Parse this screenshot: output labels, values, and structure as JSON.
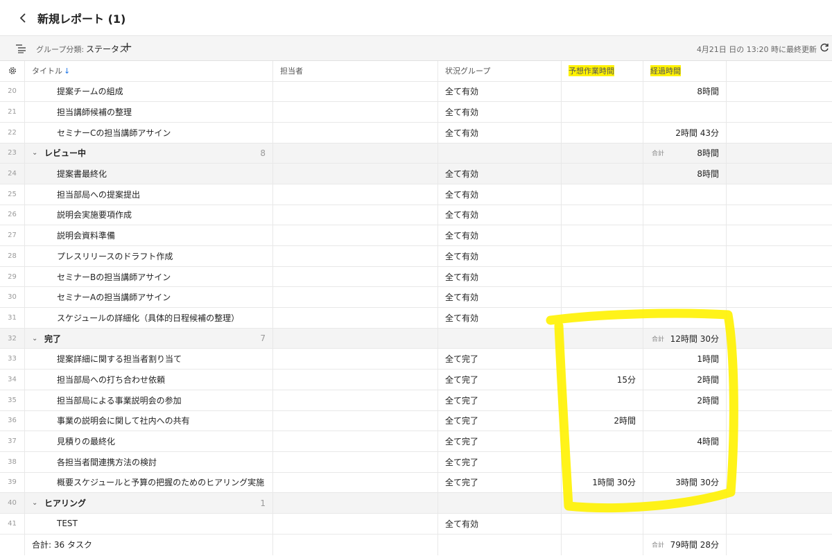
{
  "titlebar": {
    "title": "新規レポート (1)"
  },
  "toolbar": {
    "group_label": "グループ分類:",
    "group_value": "ステータス",
    "add": "+",
    "updated": "4月21日 日の 13:20 時に最終更新"
  },
  "columns": {
    "title": "タイトル",
    "sort": "↓",
    "assignee": "担当者",
    "status": "状況グループ",
    "estimate": "予想作業時間",
    "elapsed": "経過時間"
  },
  "rows": [
    {
      "n": "20",
      "title": "提案チームの組成",
      "status": "全て有効",
      "est": "",
      "elapsed": "8時間"
    },
    {
      "n": "21",
      "title": "担当講師候補の整理",
      "status": "全て有効",
      "est": "",
      "elapsed": ""
    },
    {
      "n": "22",
      "title": "セミナーCの担当講師アサイン",
      "status": "全て有効",
      "est": "",
      "elapsed": "2時間 43分"
    },
    {
      "n": "23",
      "group": "レビュー中",
      "count": "8",
      "sum_label": "合計",
      "elapsed": "8時間"
    },
    {
      "n": "24",
      "title": "提案書最終化",
      "status": "全て有効",
      "est": "",
      "elapsed": "8時間"
    },
    {
      "n": "25",
      "title": "担当部局への提案提出",
      "status": "全て有効",
      "est": "",
      "elapsed": ""
    },
    {
      "n": "26",
      "title": "説明会実施要項作成",
      "status": "全て有効",
      "est": "",
      "elapsed": ""
    },
    {
      "n": "27",
      "title": "説明会資料準備",
      "status": "全て有効",
      "est": "",
      "elapsed": ""
    },
    {
      "n": "28",
      "title": "プレスリリースのドラフト作成",
      "status": "全て有効",
      "est": "",
      "elapsed": ""
    },
    {
      "n": "29",
      "title": "セミナーBの担当講師アサイン",
      "status": "全て有効",
      "est": "",
      "elapsed": ""
    },
    {
      "n": "30",
      "title": "セミナーAの担当講師アサイン",
      "status": "全て有効",
      "est": "",
      "elapsed": ""
    },
    {
      "n": "31",
      "title": "スケジュールの詳細化（具体的日程候補の整理）",
      "status": "全て有効",
      "est": "",
      "elapsed": ""
    },
    {
      "n": "32",
      "group": "完了",
      "count": "7",
      "sum_label": "合計",
      "elapsed": "12時間 30分"
    },
    {
      "n": "33",
      "title": "提案詳細に関する担当者割り当て",
      "status": "全て完了",
      "est": "",
      "elapsed": "1時間"
    },
    {
      "n": "34",
      "title": "担当部局への打ち合わせ依頼",
      "status": "全て完了",
      "est": "15分",
      "elapsed": "2時間"
    },
    {
      "n": "35",
      "title": "担当部局による事業説明会の参加",
      "status": "全て完了",
      "est": "",
      "elapsed": "2時間"
    },
    {
      "n": "36",
      "title": "事業の説明会に関して社内への共有",
      "status": "全て完了",
      "est": "2時間",
      "elapsed": ""
    },
    {
      "n": "37",
      "title": "見積りの最終化",
      "status": "全て完了",
      "est": "",
      "elapsed": "4時間"
    },
    {
      "n": "38",
      "title": "各担当者間連携方法の検討",
      "status": "全て完了",
      "est": "",
      "elapsed": ""
    },
    {
      "n": "39",
      "title": "概要スケジュールと予算の把握のためのヒアリング実施",
      "status": "全て完了",
      "est": "1時間 30分",
      "elapsed": "3時間 30分"
    },
    {
      "n": "40",
      "group": "ヒアリング",
      "count": "1",
      "sum_label": "",
      "elapsed": ""
    },
    {
      "n": "41",
      "title": "TEST",
      "status": "全て有効",
      "est": "",
      "elapsed": ""
    }
  ],
  "footer": {
    "total": "合計: 36 タスク",
    "sum_label": "合計",
    "elapsed": "79時間 28分"
  },
  "colors": {
    "highlight": "#fff200",
    "accent": "#1a73e8"
  }
}
